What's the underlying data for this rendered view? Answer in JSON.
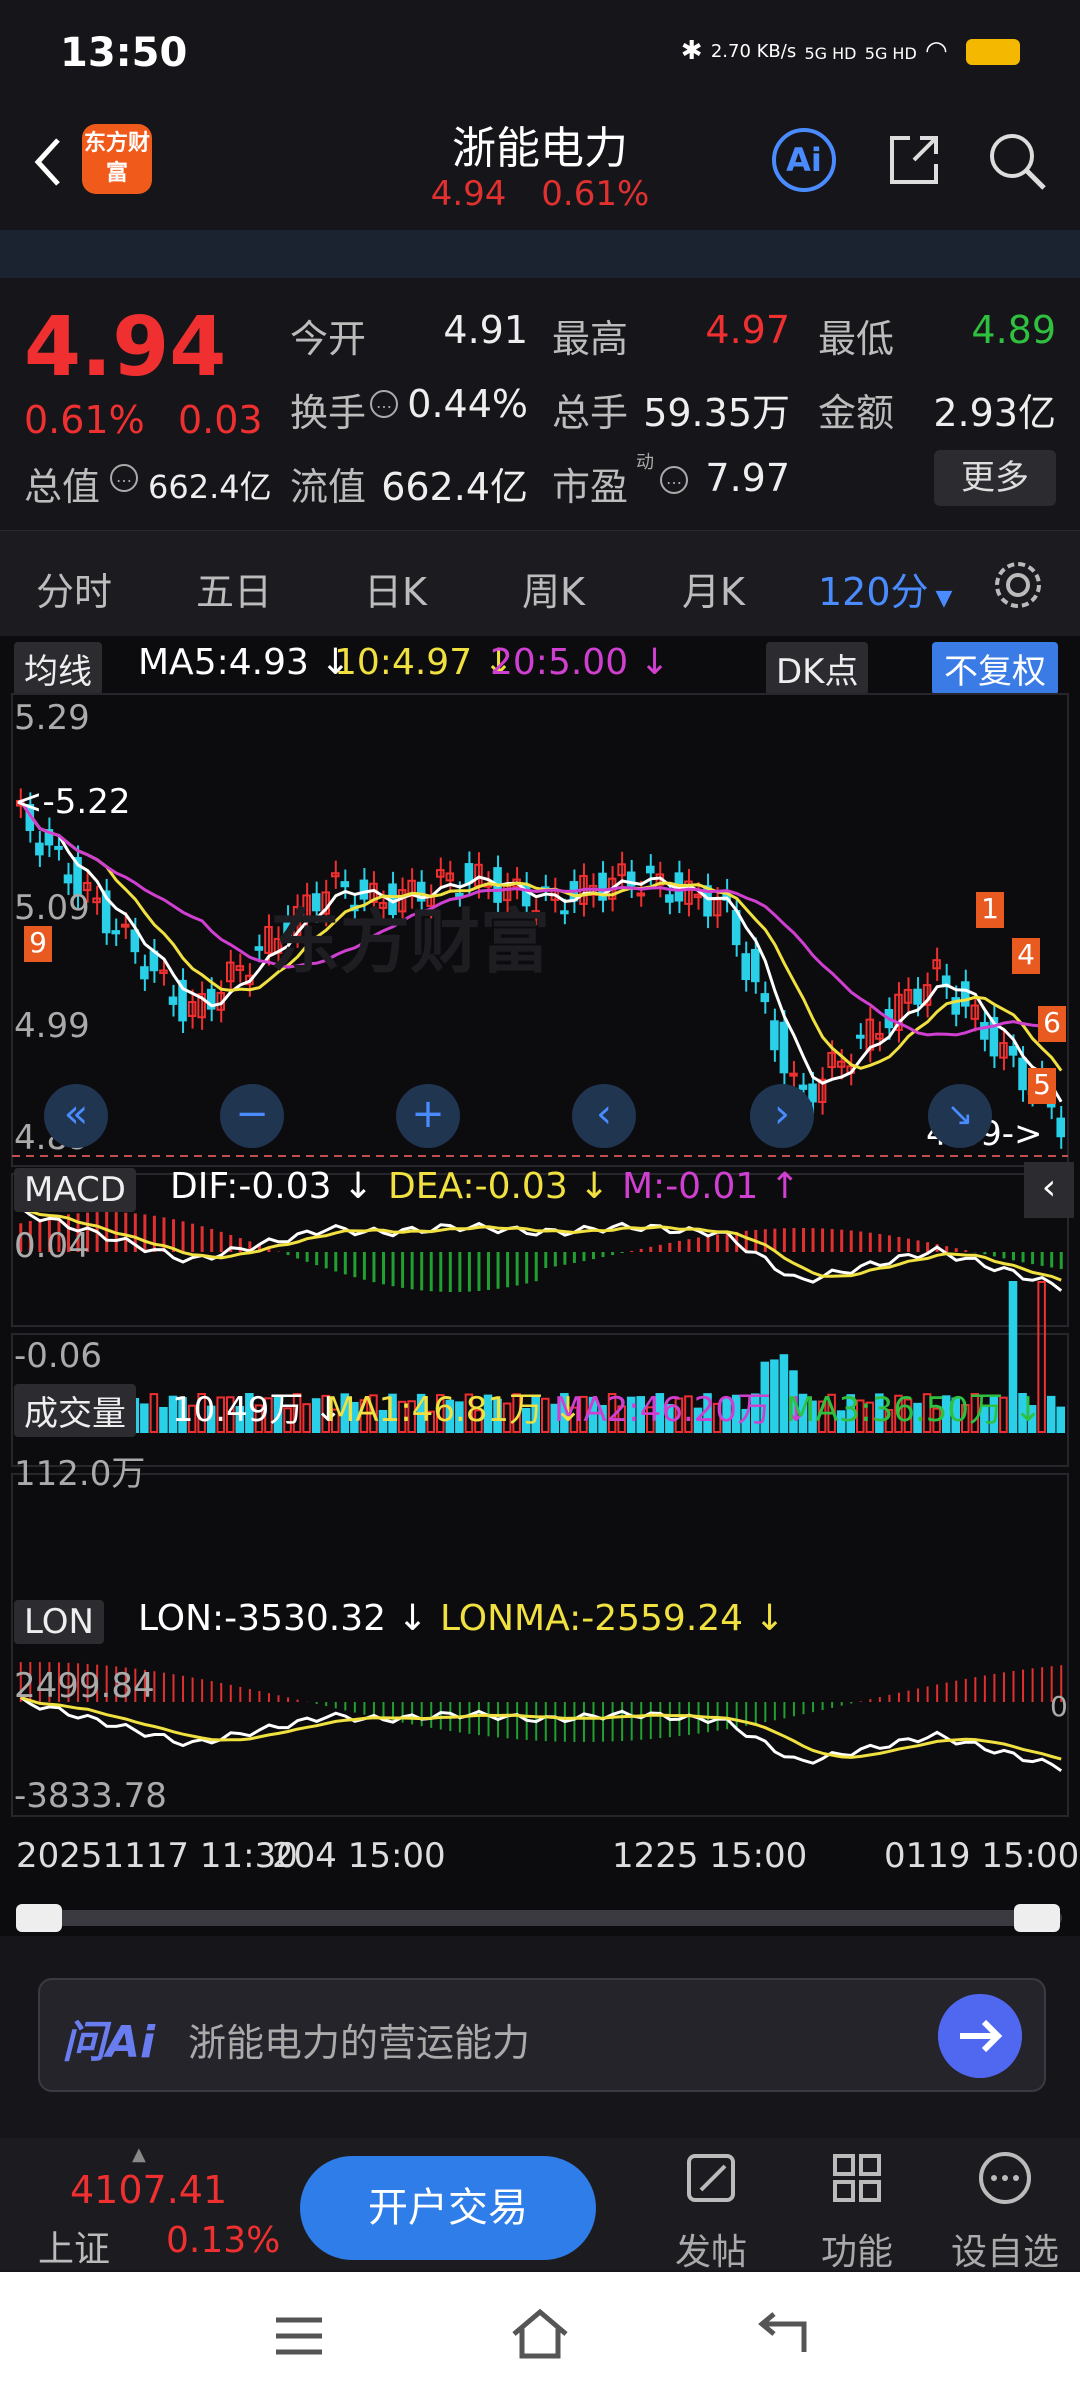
{
  "status": {
    "time": "13:50",
    "speed": "2.70\nKB/s",
    "net1": "5G HD",
    "net2": "5G HD"
  },
  "header": {
    "logo": "东方财富",
    "title": "浙能电力",
    "price": "4.94",
    "change_pct": "0.61%",
    "ai_label": "Ai"
  },
  "quote": {
    "price": "4.94",
    "change_pct": "0.61%",
    "change": "0.03",
    "open_label": "今开",
    "open": "4.91",
    "high_label": "最高",
    "high": "4.97",
    "low_label": "最低",
    "low": "4.89",
    "turnover_label": "换手",
    "turnover": "0.44%",
    "volume_label": "总手",
    "volume": "59.35万",
    "amount_label": "金额",
    "amount": "2.93亿",
    "mktcap_label": "总值",
    "mktcap": "662.4亿",
    "float_label": "流值",
    "float_cap": "662.4亿",
    "pe_label": "市盈",
    "pe_sup": "动",
    "pe": "7.97",
    "more": "更多"
  },
  "tabs": [
    "分时",
    "五日",
    "日K",
    "周K",
    "月K",
    "120分"
  ],
  "chart": {
    "ma_chip": "均线",
    "ma5": "MA5:4.93 ↓",
    "ma10": "10:4.97 ↓",
    "ma20": "20:5.00 ↓",
    "dk": "DK点",
    "fq": "不复权",
    "y_top": "5.29",
    "y_mid": "5.09",
    "y_low": "4.99",
    "y_bot": "4.89",
    "hi_marker": "<-5.22",
    "lo_marker": "4.89->",
    "badge_9": "9",
    "badge_1": "1",
    "badge_4": "4",
    "badge_6": "6",
    "badge_5": "5",
    "watermark": "东方财富",
    "macd_chip": "MACD",
    "dif": "DIF:-0.03 ↓",
    "dea": "DEA:-0.03 ↓",
    "m": "M:-0.01 ↑",
    "macd_top": "0.04",
    "macd_bot": "-0.06",
    "vol_chip": "成交量",
    "vol": "10.49万 ↓",
    "vma1": "MA1:46.81万 ↓",
    "vma2": "MA2:46.20万 ↓",
    "vma3": "MA3:36.50万 ↓",
    "vol_top": "112.0万",
    "lon_chip": "LON",
    "lon": "LON:-3530.32 ↓",
    "lonma": "LONMA:-2559.24 ↓",
    "lon_top": "2499.84",
    "lon_bot": "-3833.78",
    "lon_right": "0",
    "x1": "20251117 11:30",
    "x1b": "204 15:00",
    "x2": "1225 15:00",
    "x3": "0119 15:00"
  },
  "ask": {
    "logo": "问Ai",
    "text": "浙能电力的营运能力"
  },
  "bottom": {
    "index_value": "4107.41",
    "index_name": "上证",
    "index_change": "0.13%",
    "trade": "开户交易",
    "post": "发帖",
    "func": "功能",
    "watch": "设自选"
  },
  "colors": {
    "up": "#f03030",
    "down": "#2ad0e8",
    "ma5": "#ffffff",
    "ma10": "#f0e040",
    "ma20": "#d040d0",
    "accent": "#3a7be6"
  }
}
